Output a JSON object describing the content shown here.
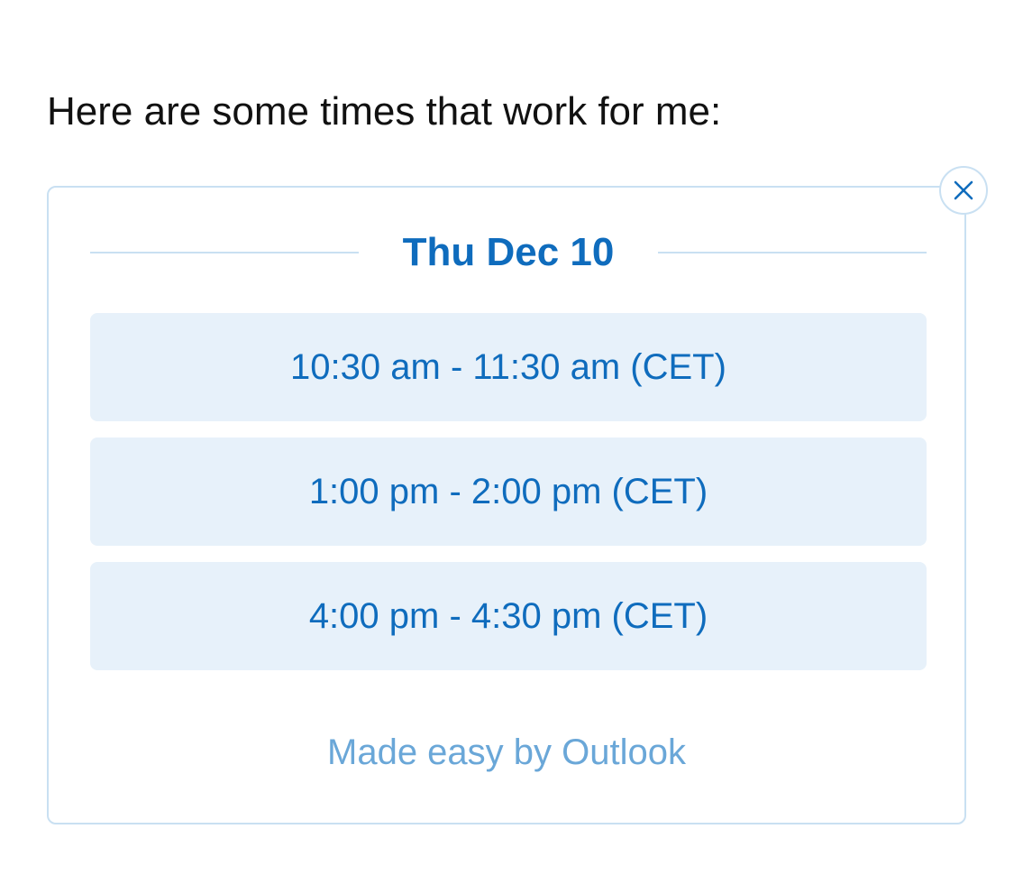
{
  "intro_text": "Here are some times that work for me:",
  "card": {
    "date": "Thu Dec 10",
    "slots": [
      {
        "label": "10:30 am - 11:30 am (CET)"
      },
      {
        "label": "1:00 pm - 2:00 pm (CET)"
      },
      {
        "label": "4:00 pm - 4:30 pm (CET)"
      }
    ],
    "footer": "Made easy by Outlook",
    "close_icon": "close-icon"
  },
  "colors": {
    "accent": "#0f6cbd",
    "slot_background": "#e7f1fa",
    "border": "#c9e0f2",
    "footer_text": "#6aa7d8"
  }
}
